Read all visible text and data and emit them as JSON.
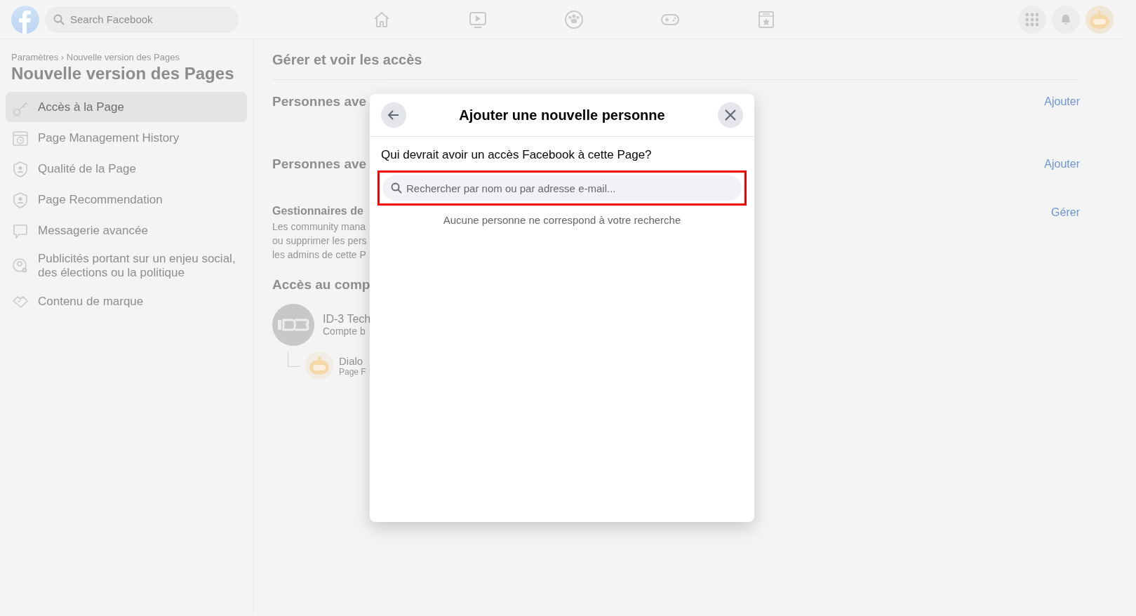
{
  "topbar": {
    "search": {
      "placeholder": "Search Facebook"
    },
    "nav": [
      {
        "kind": "home",
        "selected": false
      },
      {
        "kind": "video",
        "selected": false
      },
      {
        "kind": "groups",
        "selected": false
      },
      {
        "kind": "gaming",
        "selected": false
      },
      {
        "kind": "pages",
        "selected": false
      }
    ]
  },
  "sidebar": {
    "breadcrumb": "Paramètres › Nouvelle version des Pages",
    "title": "Nouvelle version des Pages",
    "items": [
      {
        "label": "Accès à la Page",
        "kind": "key",
        "selected": true
      },
      {
        "label": "Page Management History",
        "kind": "history",
        "selected": false
      },
      {
        "label": "Qualité de la Page",
        "kind": "shield",
        "selected": false
      },
      {
        "label": "Page Recommendation",
        "kind": "shield",
        "selected": false
      },
      {
        "label": "Messagerie avancée",
        "kind": "chat",
        "selected": false
      },
      {
        "label": "Publicités portant sur un enjeu social, des élections ou la politique",
        "kind": "person-gear",
        "selected": false
      },
      {
        "label": "Contenu de marque",
        "kind": "handshake",
        "selected": false
      }
    ]
  },
  "main": {
    "heading": "Gérer et voir les accès",
    "sections": [
      {
        "kind": "plain",
        "title": "Personnes ave",
        "action": "Ajouter"
      },
      {
        "kind": "plain",
        "title": "Personnes ave",
        "action": "Ajouter"
      },
      {
        "kind": "described",
        "title": "Gestionnaires de",
        "lines": [
          "Les community mana",
          "ou supprimer les pers",
          "les admins de cette P"
        ],
        "action": "Gérer"
      }
    ],
    "accounts": {
      "title": "Accès au comp",
      "business": {
        "name": "ID-3 Tech",
        "subtitle": "Compte b"
      },
      "page": {
        "name": "Dialo",
        "subtitle": "Page F"
      }
    }
  },
  "modal": {
    "title": "Ajouter une nouvelle personne",
    "question": "Qui devrait avoir un accès Facebook à cette Page?",
    "search": {
      "placeholder": "Rechercher par nom ou par adresse e-mail...",
      "highlighted": true
    },
    "empty_message": "Aucune personne ne correspond à votre recherche"
  }
}
